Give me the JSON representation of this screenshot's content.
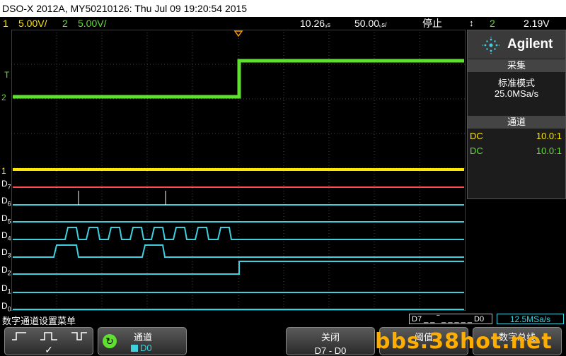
{
  "title": "DSO-X 2012A, MY50210126: Thu Jul 09 19:20:54 2015",
  "status": {
    "ch1_num": "1",
    "ch1_scale": "5.00V/",
    "ch2_num": "2",
    "ch2_scale": "5.00V/",
    "time_ref": "10.26",
    "timebase": "50.00",
    "run_state": "停止",
    "trig_source": "2",
    "trig_level": "2.19V"
  },
  "brand": "Agilent",
  "acquire": {
    "header": "采集",
    "mode": "标准模式",
    "rate": "25.0MSa/s"
  },
  "channels": {
    "header": "通道",
    "rows": [
      {
        "coupling": "DC",
        "probe": "10.0:1",
        "color": "#ffe600"
      },
      {
        "coupling": "DC",
        "probe": "10.0:1",
        "color": "#5fe030"
      }
    ]
  },
  "digital_labels": [
    "D7",
    "D6",
    "D5",
    "D4",
    "D3",
    "D2",
    "D1",
    "D0"
  ],
  "markers": {
    "trigger": "T",
    "ch2": "2",
    "ch1": "1"
  },
  "menu": {
    "title": "数字通道设置菜单",
    "bus_indicator": "D7 _ _ ‾ _  _ _ _ _ D0",
    "sample_rate": "12.5MSa/s",
    "channel_label": "通道",
    "channel_value": "D0",
    "close_label": "关闭",
    "close_value": "D7 - D0",
    "threshold_label": "阈值",
    "bus_label": "数字总线"
  },
  "watermark": "bbs.38hot.net"
}
